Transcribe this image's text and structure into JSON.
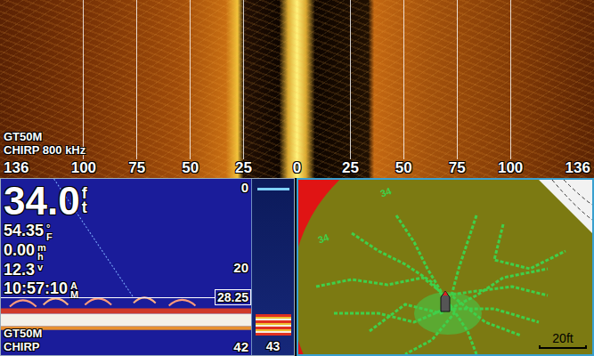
{
  "sidescan": {
    "transducer": "GT50M",
    "mode": "CHIRP 800 kHz",
    "scale": [
      "136",
      "100",
      "75",
      "50",
      "25",
      "0",
      "25",
      "50",
      "75",
      "100",
      "136"
    ]
  },
  "downview": {
    "depth": "34.0",
    "depth_unit": "ft",
    "readings": [
      {
        "value": "54.35",
        "unit": "°F"
      },
      {
        "value": "0.00",
        "unit": "mh"
      },
      {
        "value": "12.3",
        "unit": "v"
      },
      {
        "value": "10:57:10",
        "unit": "AM"
      }
    ],
    "scale": [
      "0",
      "20",
      "42"
    ],
    "cursor_depth": "28.25",
    "transducer": "GT50M",
    "mode": "CHIRP",
    "flasher_depth": "43"
  },
  "map": {
    "contour_labels": [
      "34",
      "34"
    ],
    "scale_bar": "20ft"
  }
}
